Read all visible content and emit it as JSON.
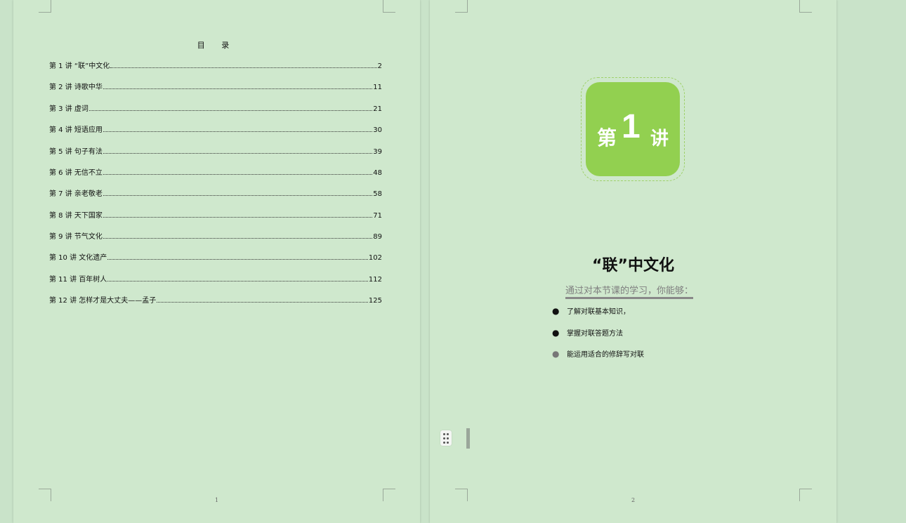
{
  "toc": {
    "title": "目 录",
    "entries": [
      {
        "label": "第 1 讲 “联”中文化",
        "page": "2"
      },
      {
        "label": "第 2 讲 诗歌中华",
        "page": "11"
      },
      {
        "label": "第 3 讲 虚词",
        "page": "21"
      },
      {
        "label": "第 4 讲 短语应用",
        "page": "30"
      },
      {
        "label": "第 5 讲 句子有法",
        "page": "39"
      },
      {
        "label": "第 6 讲 无信不立",
        "page": "48"
      },
      {
        "label": "第 7 讲 亲老敬老",
        "page": "58"
      },
      {
        "label": "第 8 讲 天下国家",
        "page": "71"
      },
      {
        "label": "第 9 讲 节气文化",
        "page": "89"
      },
      {
        "label": "第 10 讲 文化遗产",
        "page": "102"
      },
      {
        "label": "第 11 讲 百年树人",
        "page": "112"
      },
      {
        "label": "第 12 讲 怎样才是大丈夫——孟子",
        "page": "125"
      }
    ]
  },
  "page1": {
    "page_number": "1"
  },
  "page2": {
    "badge": {
      "prefix": "第",
      "number": "1",
      "suffix": "讲",
      "color": "#92d050"
    },
    "lesson_title": "“联”中文化",
    "subtitle": "通过对本节课的学习，你能够：",
    "objectives": [
      "了解对联基本知识，",
      "掌握对联答题方法",
      "能运用适合的修辞写对联"
    ],
    "page_number": "2"
  }
}
